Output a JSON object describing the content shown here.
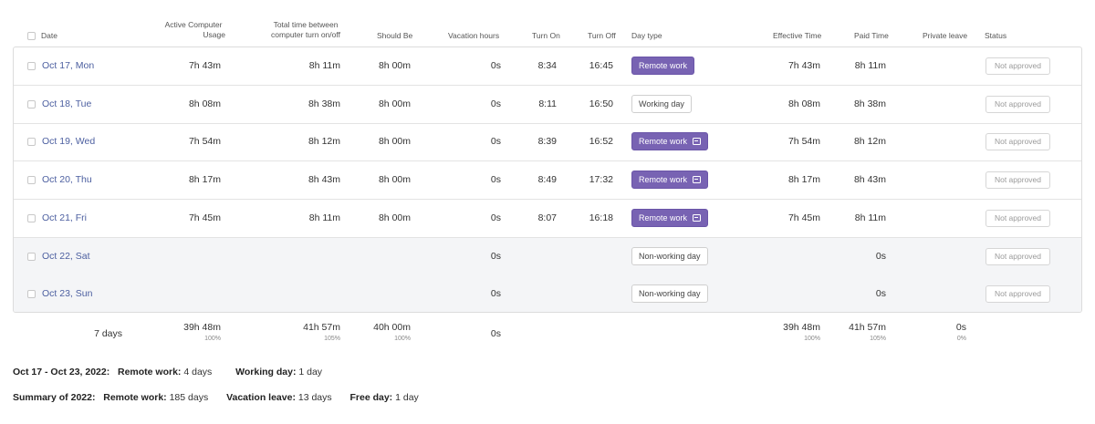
{
  "headers": {
    "date": "Date",
    "active_line1": "Active Computer",
    "active_line2": "Usage",
    "total_line1": "Total time between",
    "total_line2": "computer turn on/off",
    "should_be": "Should Be",
    "vacation_hours": "Vacation hours",
    "turn_on": "Turn On",
    "turn_off": "Turn Off",
    "day_type": "Day type",
    "effective_time": "Effective Time",
    "paid_time": "Paid Time",
    "private_leave": "Private leave",
    "status": "Status"
  },
  "rows": [
    {
      "date": "Oct 17, Mon",
      "active": "7h 43m",
      "total": "8h 11m",
      "should": "8h 00m",
      "vacation": "0s",
      "on": "8:34",
      "off": "16:45",
      "day_type": "Remote work",
      "remote": true,
      "comment": false,
      "effective": "7h 43m",
      "paid": "8h 11m",
      "status": "Not approved"
    },
    {
      "date": "Oct 18, Tue",
      "active": "8h 08m",
      "total": "8h 38m",
      "should": "8h 00m",
      "vacation": "0s",
      "on": "8:11",
      "off": "16:50",
      "day_type": "Working day",
      "remote": false,
      "comment": false,
      "effective": "8h 08m",
      "paid": "8h 38m",
      "status": "Not approved"
    },
    {
      "date": "Oct 19, Wed",
      "active": "7h 54m",
      "total": "8h 12m",
      "should": "8h 00m",
      "vacation": "0s",
      "on": "8:39",
      "off": "16:52",
      "day_type": "Remote work",
      "remote": true,
      "comment": true,
      "effective": "7h 54m",
      "paid": "8h 12m",
      "status": "Not approved"
    },
    {
      "date": "Oct 20, Thu",
      "active": "8h 17m",
      "total": "8h 43m",
      "should": "8h 00m",
      "vacation": "0s",
      "on": "8:49",
      "off": "17:32",
      "day_type": "Remote work",
      "remote": true,
      "comment": true,
      "effective": "8h 17m",
      "paid": "8h 43m",
      "status": "Not approved"
    },
    {
      "date": "Oct 21, Fri",
      "active": "7h 45m",
      "total": "8h 11m",
      "should": "8h 00m",
      "vacation": "0s",
      "on": "8:07",
      "off": "16:18",
      "day_type": "Remote work",
      "remote": true,
      "comment": true,
      "effective": "7h 45m",
      "paid": "8h 11m",
      "status": "Not approved"
    },
    {
      "date": "Oct 22, Sat",
      "active": "",
      "total": "",
      "should": "",
      "vacation": "0s",
      "on": "",
      "off": "",
      "day_type": "Non-working day",
      "remote": false,
      "comment": false,
      "effective": "",
      "paid": "0s",
      "status": "Not approved",
      "weekend": true
    },
    {
      "date": "Oct 23, Sun",
      "active": "",
      "total": "",
      "should": "",
      "vacation": "0s",
      "on": "",
      "off": "",
      "day_type": "Non-working day",
      "remote": false,
      "comment": false,
      "effective": "",
      "paid": "0s",
      "status": "Not approved",
      "weekend": true
    }
  ],
  "totals": {
    "days": "7 days",
    "active": "39h 48m",
    "active_pct": "100%",
    "total": "41h 57m",
    "total_pct": "105%",
    "should": "40h 00m",
    "should_pct": "100%",
    "vacation": "0s",
    "effective": "39h 48m",
    "effective_pct": "100%",
    "paid": "41h 57m",
    "paid_pct": "105%",
    "private": "0s",
    "private_pct": "0%"
  },
  "week_summary": {
    "range": "Oct 17 - Oct 23, 2022:",
    "remote_label": "Remote work:",
    "remote_value": "4 days",
    "working_label": "Working day:",
    "working_value": "1 day"
  },
  "year_summary": {
    "label": "Summary of 2022:",
    "remote_label": "Remote work:",
    "remote_value": "185 days",
    "vacation_label": "Vacation leave:",
    "vacation_value": "13 days",
    "free_label": "Free day:",
    "free_value": "1 day"
  },
  "colors": {
    "remote_pill": "#7863b3",
    "date_link": "#4c5fa0",
    "weekend_row": "#f4f5f7"
  }
}
